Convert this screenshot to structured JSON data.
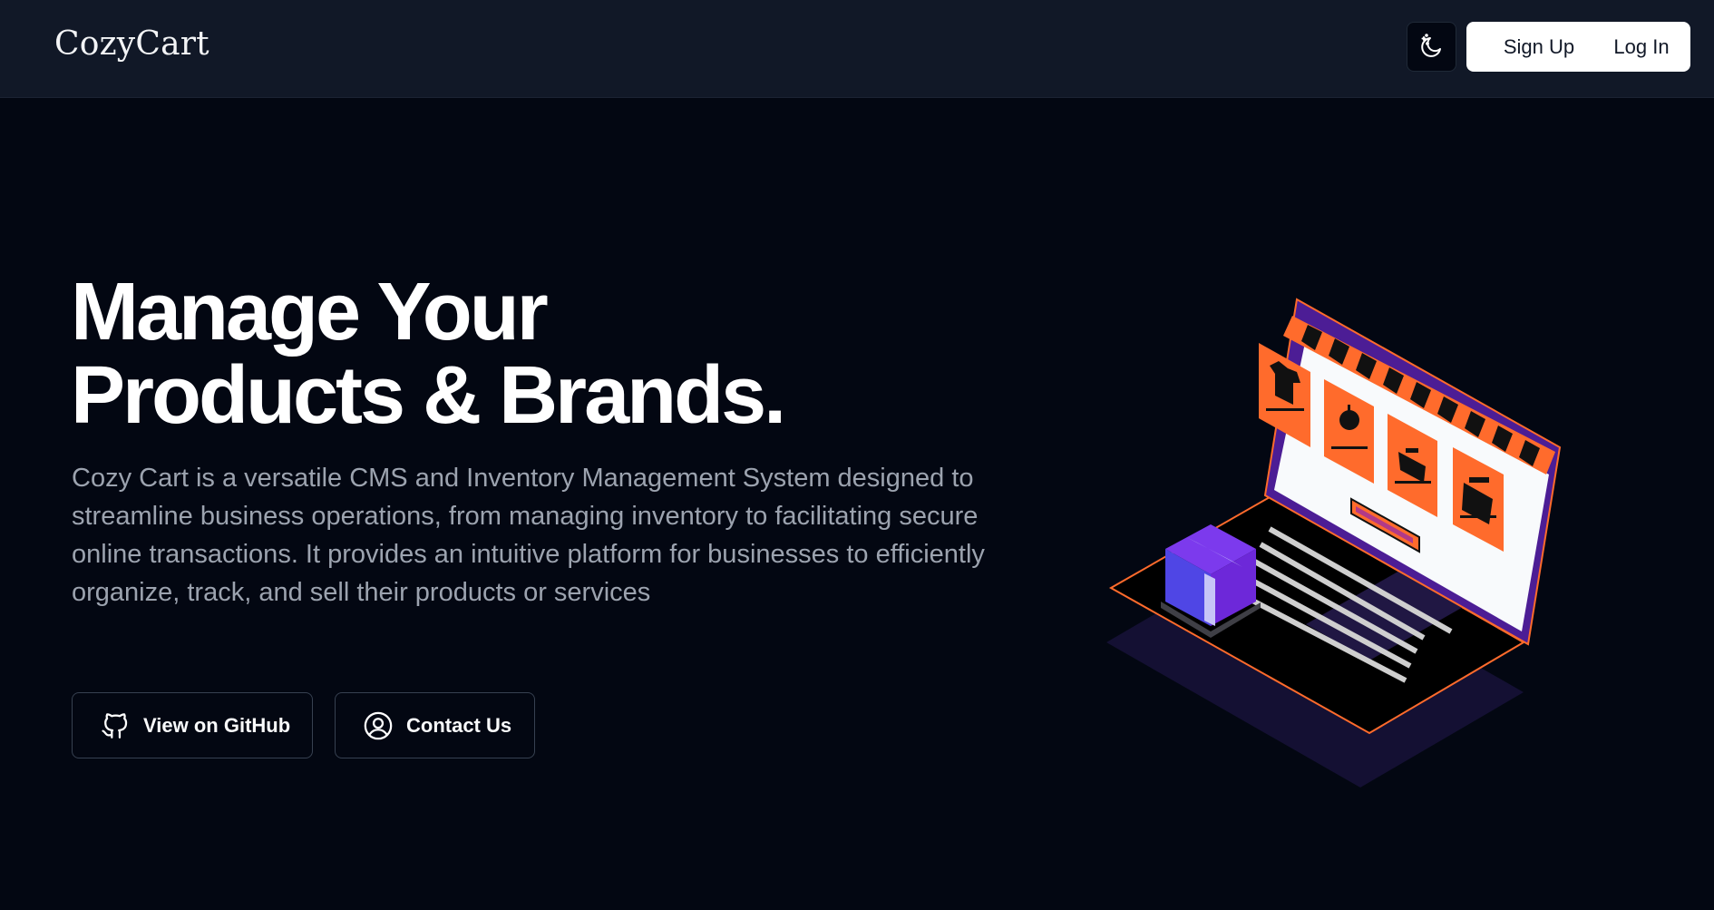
{
  "header": {
    "brand": "CozyCart",
    "theme_toggle_icon": "moon-stars-icon",
    "signup_label": "Sign Up",
    "login_label": "Log In"
  },
  "hero": {
    "title_line1": "Manage Your",
    "title_line2": "Products & Brands.",
    "description": "Cozy Cart is a versatile CMS and Inventory Management System designed to streamline business operations, from managing inventory to facilitating secure online transactions. It provides an intuitive platform for businesses to efficiently organize, track, and sell their products or services",
    "github_label": "View on GitHub",
    "github_icon": "github-icon",
    "contact_label": "Contact Us",
    "contact_icon": "user-circle-icon"
  },
  "illustration": {
    "icon": "laptop-storefront-illustration",
    "colors": {
      "accent_orange": "#ff6b2c",
      "accent_purple": "#5b21b6",
      "screen": "#f8fafc",
      "shadow": "#1e1b4b"
    }
  }
}
